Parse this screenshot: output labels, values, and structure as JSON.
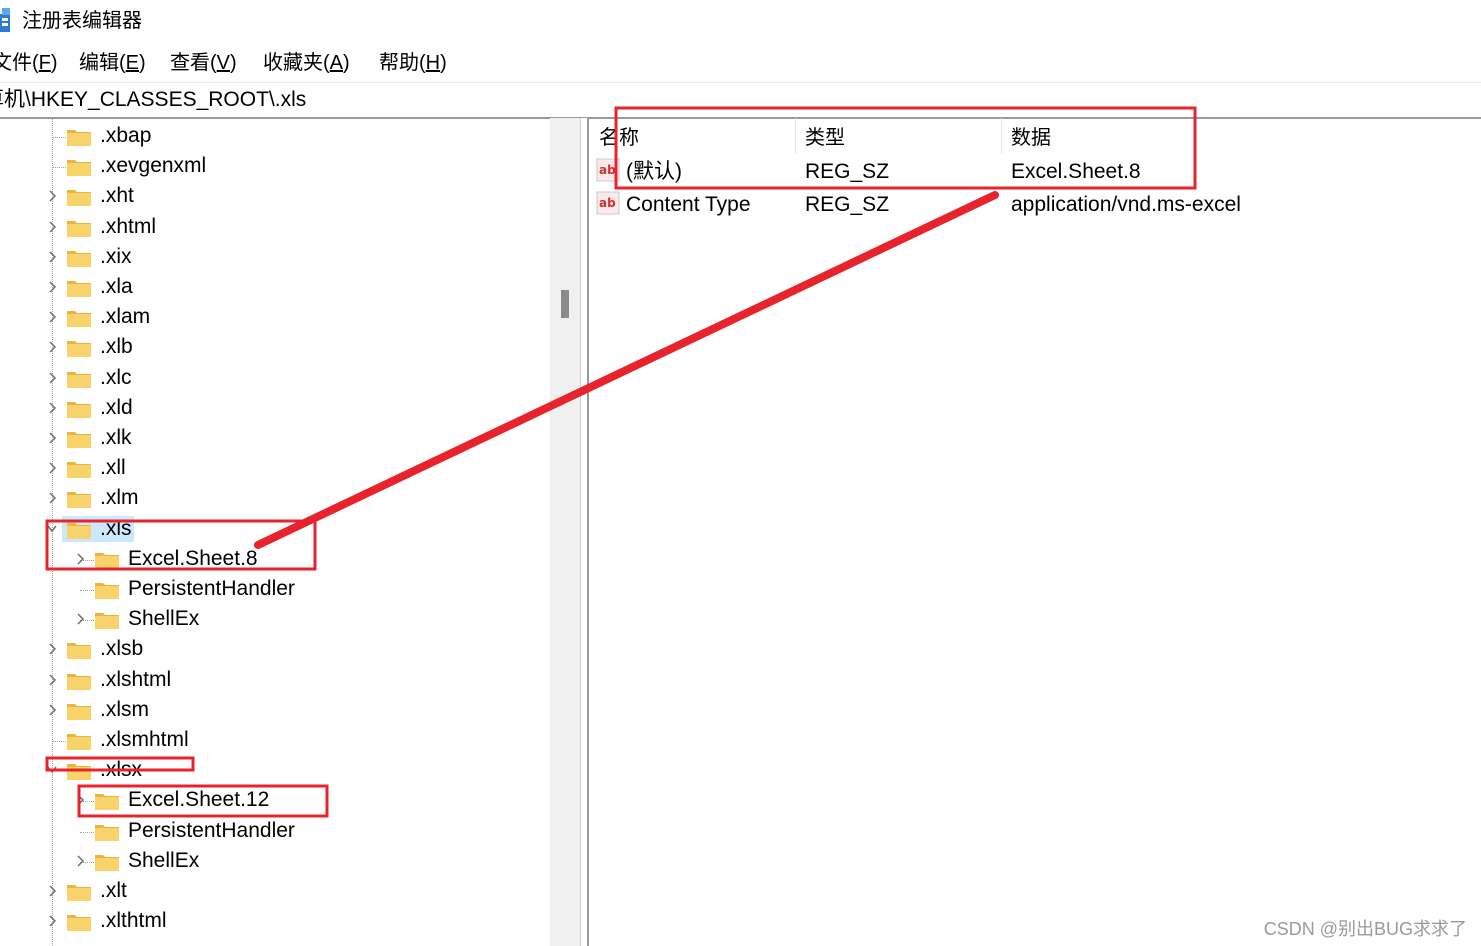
{
  "window": {
    "title": "注册表编辑器"
  },
  "menu": [
    {
      "label": "文件",
      "accel": "F"
    },
    {
      "label": "编辑",
      "accel": "E"
    },
    {
      "label": "查看",
      "accel": "V"
    },
    {
      "label": "收藏夹",
      "accel": "A"
    },
    {
      "label": "帮助",
      "accel": "H"
    }
  ],
  "address": "计算机\\HKEY_CLASSES_ROOT\\.xls",
  "tree": {
    "items": [
      {
        "label": ".xbap"
      },
      {
        "label": ".xevgenxml"
      },
      {
        "label": ".xht"
      },
      {
        "label": ".xhtml"
      },
      {
        "label": ".xix"
      },
      {
        "label": ".xla"
      },
      {
        "label": ".xlam"
      },
      {
        "label": ".xlb"
      },
      {
        "label": ".xlc"
      },
      {
        "label": ".xld"
      },
      {
        "label": ".xlk"
      },
      {
        "label": ".xll"
      },
      {
        "label": ".xlm"
      },
      {
        "label": ".xls",
        "selected": true,
        "expanded": true
      },
      {
        "label": "Excel.Sheet.8"
      },
      {
        "label": "PersistentHandler"
      },
      {
        "label": "ShellEx"
      },
      {
        "label": ".xlsb"
      },
      {
        "label": ".xlshtml"
      },
      {
        "label": ".xlsm"
      },
      {
        "label": ".xlsmhtml"
      },
      {
        "label": ".xlsx",
        "expanded": true
      },
      {
        "label": "Excel.Sheet.12"
      },
      {
        "label": "PersistentHandler"
      },
      {
        "label": "ShellEx"
      },
      {
        "label": ".xlt"
      },
      {
        "label": ".xlthtml"
      }
    ]
  },
  "values": {
    "columns": [
      "名称",
      "类型",
      "数据"
    ],
    "rows": [
      {
        "name": "(默认)",
        "type": "REG_SZ",
        "data": "Excel.Sheet.8"
      },
      {
        "name": "Content Type",
        "type": "REG_SZ",
        "data": "application/vnd.ms-excel"
      }
    ]
  },
  "annotation_color": "#e8232b",
  "watermark": "CSDN @别出BUG求求了"
}
